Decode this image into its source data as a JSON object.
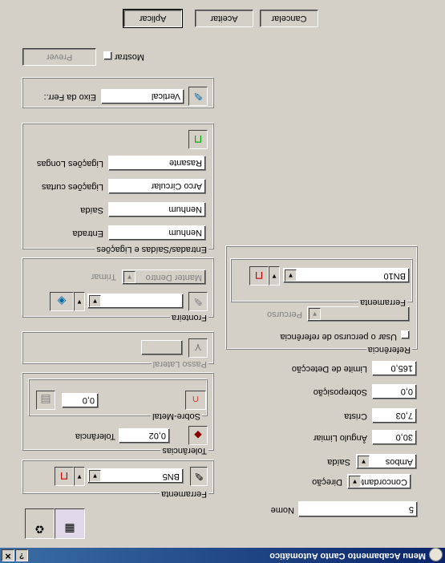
{
  "window": {
    "title": "Menu Acabamento Canto Automático",
    "help_label": "?",
    "close_label": "✕"
  },
  "nome": {
    "label": "Nome",
    "value": "5"
  },
  "ferramenta_main": {
    "label": "Ferramenta",
    "value": "BN5"
  },
  "tolerancias": {
    "label": "Tolerâncias",
    "tol_label": "Tolerância",
    "tol_value": "0,02"
  },
  "sobre_metal": {
    "label": "Sobre-Metal",
    "value": "0,0"
  },
  "passo_lateral": {
    "label": "Passo Lateral",
    "value": ""
  },
  "fronteira": {
    "label": "Fronteira",
    "value": "",
    "trimar_label": "Trimar",
    "trimar_value": "Manter Dentro"
  },
  "ligacoes": {
    "label": "Entradas/Saídas e Ligações",
    "entrada_label": "Entrada",
    "entrada_value": "Nenhum",
    "saida_label": "Saída",
    "saida_value": "Nenhum",
    "curtas_label": "Ligações curtas",
    "curtas_value": "Arco Circular",
    "longas_label": "Ligações Longas",
    "longas_value": "Rasante"
  },
  "eixo": {
    "label": "Eixo da Ferr.",
    "field_label": "Eixo da Ferr.:",
    "value": "Vertical"
  },
  "preview": {
    "prever_label": "Prever",
    "mostrar_label": "Mostrar"
  },
  "right": {
    "direcao_label": "Direção",
    "direcao_value": "Concordante",
    "saida_label": "Saída",
    "saida_value": "Ambos",
    "angulo_label": "Ângulo Limiar",
    "angulo_value": "30,0",
    "crista_label": "Crista",
    "crista_value": "7,03",
    "sobreposicao_label": "Sobreposição",
    "sobreposicao_value": "0,0",
    "limite_label": "Limite de Detecção",
    "limite_value": "165,0"
  },
  "referencia": {
    "label": "Referência",
    "usar_label": "Usar o percurso de referência",
    "percurso_label": "Percurso",
    "percurso_value": "",
    "ferramenta_label": "Ferramenta",
    "ferramenta_value": "BN10"
  },
  "actions": {
    "aplicar": "Aplicar",
    "aceitar": "Aceitar",
    "cancelar": "Cancelar"
  }
}
